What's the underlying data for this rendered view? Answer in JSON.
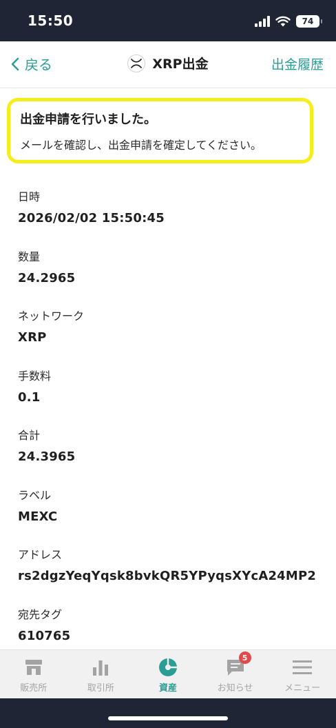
{
  "status_bar": {
    "time": "15:50",
    "battery": "74"
  },
  "nav": {
    "back_label": "戻る",
    "title": "XRP出金",
    "history_label": "出金履歴"
  },
  "notice": {
    "title": "出金申請を行いました。",
    "body": "メールを確認し、出金申請を確定してください。",
    "border_color": "#f5ee1a"
  },
  "details": [
    {
      "label": "日時",
      "value": "2026/02/02 15:50:45"
    },
    {
      "label": "数量",
      "value": "24.2965"
    },
    {
      "label": "ネットワーク",
      "value": "XRP"
    },
    {
      "label": "手数料",
      "value": "0.1"
    },
    {
      "label": "合計",
      "value": "24.3965"
    },
    {
      "label": "ラベル",
      "value": "MEXC"
    },
    {
      "label": "アドレス",
      "value": "rs2dgzYeqYqsk8bvkQR5YPyqsXYcA24MP2"
    },
    {
      "label": "宛先タグ",
      "value": "610765"
    }
  ],
  "tabs": [
    {
      "label": "販売所",
      "icon": "storefront-icon"
    },
    {
      "label": "取引所",
      "icon": "bar-chart-icon"
    },
    {
      "label": "資産",
      "icon": "pie-chart-icon",
      "active": true
    },
    {
      "label": "お知らせ",
      "icon": "message-icon",
      "badge": "5"
    },
    {
      "label": "メニュー",
      "icon": "hamburger-menu-icon"
    }
  ],
  "colors": {
    "accent": "#2a9d95",
    "status_bar": "#1f2534",
    "badge": "#e04a4a"
  }
}
